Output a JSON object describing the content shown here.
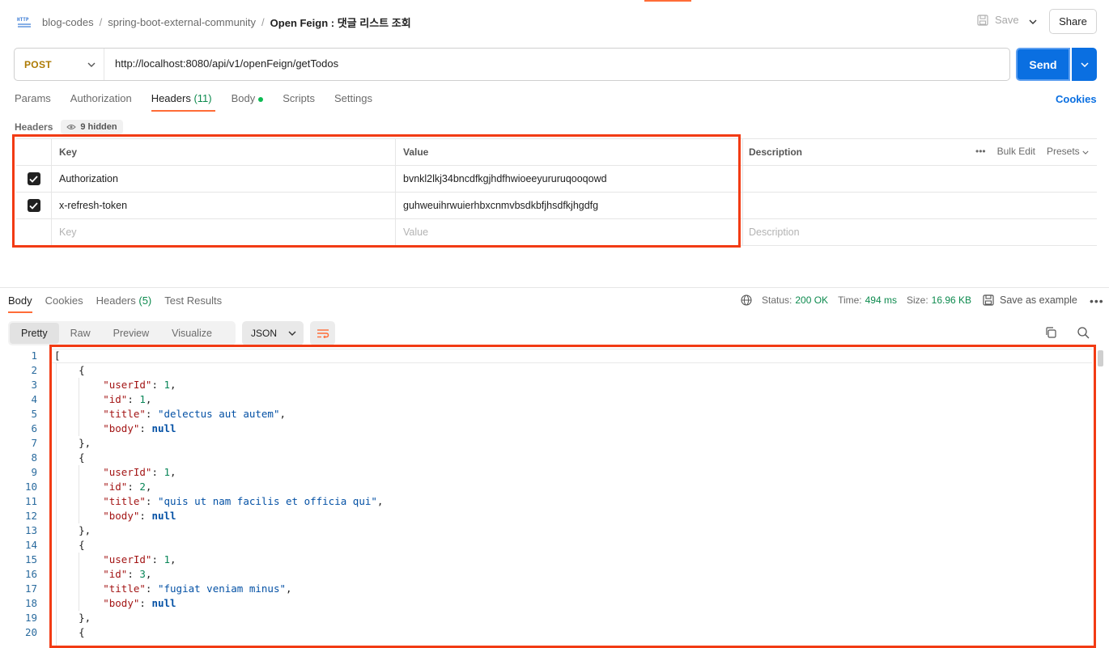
{
  "header": {
    "breadcrumb": [
      "blog-codes",
      "spring-boot-external-community",
      "Open Feign : 댓글 리스트 조회"
    ],
    "save_label": "Save",
    "share_label": "Share"
  },
  "request": {
    "method": "POST",
    "url": "http://localhost:8080/api/v1/openFeign/getTodos",
    "send_label": "Send",
    "tabs": [
      {
        "label": "Params"
      },
      {
        "label": "Authorization"
      },
      {
        "label": "Headers",
        "count": "(11)"
      },
      {
        "label": "Body"
      },
      {
        "label": "Scripts"
      },
      {
        "label": "Settings"
      }
    ],
    "cookies_label": "Cookies",
    "headers_label": "Headers",
    "hidden_label": "9 hidden"
  },
  "headers_table": {
    "columns": [
      "Key",
      "Value",
      "Description"
    ],
    "actions": [
      "Bulk Edit",
      "Presets"
    ],
    "rows": [
      {
        "key": "Authorization",
        "value": "bvnkl2lkj34bncdfkgjhdfhwioeeyururuqooqowd",
        "checked": true
      },
      {
        "key": "x-refresh-token",
        "value": "guhweuihrwuierhbxcnmvbsdkbfjhsdfkjhgdfg",
        "checked": true
      }
    ],
    "placeholders": {
      "key": "Key",
      "value": "Value",
      "description": "Description"
    }
  },
  "response": {
    "tabs": [
      {
        "label": "Body"
      },
      {
        "label": "Cookies"
      },
      {
        "label": "Headers",
        "count": "(5)"
      },
      {
        "label": "Test Results"
      }
    ],
    "status_label": "Status:",
    "status_value": "200 OK",
    "time_label": "Time:",
    "time_value": "494 ms",
    "size_label": "Size:",
    "size_value": "16.96 KB",
    "save_example_label": "Save as example",
    "view_modes": [
      "Pretty",
      "Raw",
      "Preview",
      "Visualize"
    ],
    "format": "JSON"
  },
  "code_lines": [
    "[",
    "    {",
    "        \"userId\": 1,",
    "        \"id\": 1,",
    "        \"title\": \"delectus aut autem\",",
    "        \"body\": null",
    "    },",
    "    {",
    "        \"userId\": 1,",
    "        \"id\": 2,",
    "        \"title\": \"quis ut nam facilis et officia qui\",",
    "        \"body\": null",
    "    },",
    "    {",
    "        \"userId\": 1,",
    "        \"id\": 3,",
    "        \"title\": \"fugiat veniam minus\",",
    "        \"body\": null",
    "    },",
    "    {"
  ],
  "colors": {
    "accent": "#ff6c37",
    "send": "#0a6fe1",
    "highlight_box": "#f23b14",
    "success": "#0d8a4e"
  }
}
